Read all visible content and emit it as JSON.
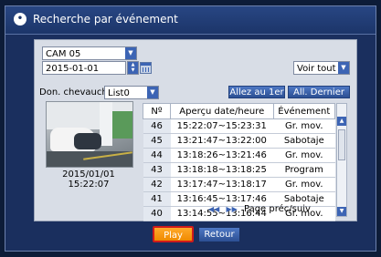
{
  "title": "Recherche par événement",
  "camera": "CAM 05",
  "date": "2015-01-01",
  "view_filter": "Voir tout",
  "overlap_label": "Don. chevauch",
  "overlap_value": "List0",
  "goto_first": "Allez au 1er",
  "goto_last": "All. Dernier",
  "preview_timestamp": "2015/01/01  15:22:07",
  "table": {
    "col_num": "Nº",
    "col_time": "Aperçu date/heure",
    "col_event": "Événement",
    "rows": [
      {
        "n": "46",
        "time": "15:22:07~15:23:31",
        "event": "Gr. mov."
      },
      {
        "n": "45",
        "time": "13:21:47~13:22:00",
        "event": "Sabotaje"
      },
      {
        "n": "44",
        "time": "13:18:26~13:21:46",
        "event": "Gr. mov."
      },
      {
        "n": "43",
        "time": "13:18:18~13:18:25",
        "event": "Program"
      },
      {
        "n": "42",
        "time": "13:17:47~13:18:17",
        "event": "Gr. mov."
      },
      {
        "n": "41",
        "time": "13:16:45~13:17:46",
        "event": "Sabotaje"
      },
      {
        "n": "40",
        "time": "13:14:55~13:16:44",
        "event": "Gr. mov."
      }
    ]
  },
  "pager_label": "Page préc/suiv",
  "play_label": "Play",
  "back_label": "Retour",
  "colors": {
    "accent": "#3c64b4",
    "play": "#f59a0f",
    "highlight": "#d01b1b"
  }
}
